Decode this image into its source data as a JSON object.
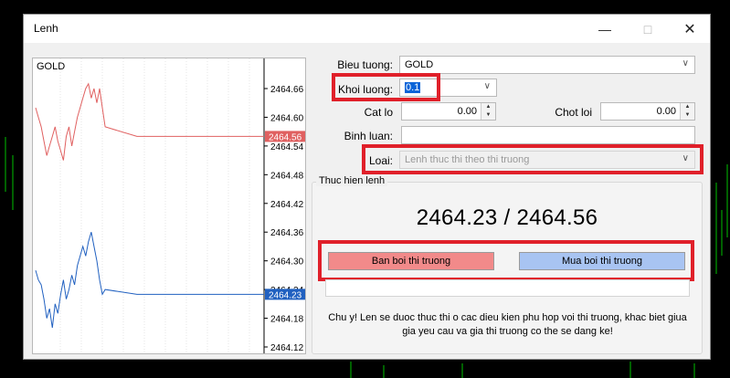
{
  "window": {
    "title": "Lenh"
  },
  "titlebar_icons": [
    "minimize-icon",
    "maximize-icon",
    "close-icon"
  ],
  "chart": {
    "symbol": "GOLD",
    "ticks": [
      "2464.66",
      "2464.60",
      "2464.54",
      "2464.48",
      "2464.42",
      "2464.36",
      "2464.30",
      "2464.24",
      "2464.18",
      "2464.12"
    ],
    "bid_tag": "2464.56",
    "ask_tag": "2464.23",
    "bid_color": "#e06060",
    "ask_color": "#2060c0",
    "ymin": 2464.12,
    "ymax": 2464.66,
    "bid_series": [
      2464.62,
      2464.6,
      2464.58,
      2464.55,
      2464.52,
      2464.54,
      2464.56,
      2464.58,
      2464.55,
      2464.53,
      2464.51,
      2464.56,
      2464.58,
      2464.54,
      2464.57,
      2464.6,
      2464.62,
      2464.64,
      2464.66,
      2464.67,
      2464.64,
      2464.66,
      2464.63,
      2464.66,
      2464.62,
      2464.58,
      2464.56,
      2464.56,
      2464.56,
      2464.56,
      2464.56
    ],
    "ask_series": [
      2464.28,
      2464.26,
      2464.25,
      2464.22,
      2464.18,
      2464.2,
      2464.16,
      2464.21,
      2464.19,
      2464.23,
      2464.26,
      2464.22,
      2464.24,
      2464.27,
      2464.25,
      2464.29,
      2464.31,
      2464.33,
      2464.31,
      2464.34,
      2464.36,
      2464.33,
      2464.3,
      2464.26,
      2464.23,
      2464.24,
      2464.23,
      2464.23,
      2464.23,
      2464.23,
      2464.23
    ]
  },
  "form": {
    "symbol_label": "Bieu tuong:",
    "symbol_value": "GOLD",
    "volume_label": "Khoi luong:",
    "volume_value": "0.1",
    "sl_label": "Cat lo",
    "sl_value": "0.00",
    "tp_label": "Chot loi",
    "tp_value": "0.00",
    "comment_label": "Binh luan:",
    "comment_value": "",
    "type_label": "Loai:",
    "type_value": "Lenh thuc thi theo thi truong"
  },
  "execution": {
    "group_title": "Thuc hien lenh",
    "price": "2464.23 / 2464.56",
    "sell_label": "Ban boi thi truong",
    "buy_label": "Mua boi thi truong",
    "note": "Chu y! Len se duoc thuc thi o cac dieu kien phu hop voi thi truong, khac biet giua gia yeu cau va gia thi truong co the se dang ke!"
  },
  "colors": {
    "highlight": "#e0202a",
    "sell": "#f28a8a",
    "buy": "#a8c4f2",
    "background_chart_green": "#00c000"
  }
}
